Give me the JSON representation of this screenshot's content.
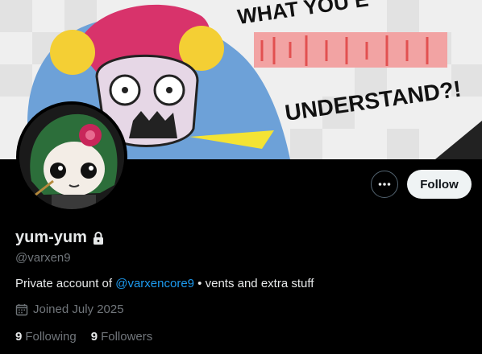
{
  "banner": {
    "caption_top": "WHAT YOU E",
    "caption_bottom": "UNDERSTAND?!"
  },
  "actions": {
    "more_label": "More",
    "follow_label": "Follow"
  },
  "profile": {
    "display_name": "yum-yum",
    "handle": "@varxen9",
    "bio_prefix": "Private account of ",
    "bio_mention": "@varxencore9",
    "bio_suffix": " • vents and extra stuff",
    "joined": "Joined July 2025"
  },
  "stats": {
    "following_count": "9",
    "following_label": "Following",
    "followers_count": "9",
    "followers_label": "Followers"
  },
  "colors": {
    "accent": "#1d9bf0",
    "background": "#000000",
    "follow_button_bg": "#eff3f4",
    "muted_text": "#71767b"
  },
  "icons": {
    "lock": "lock-icon",
    "calendar": "calendar-icon",
    "more": "more-icon"
  }
}
